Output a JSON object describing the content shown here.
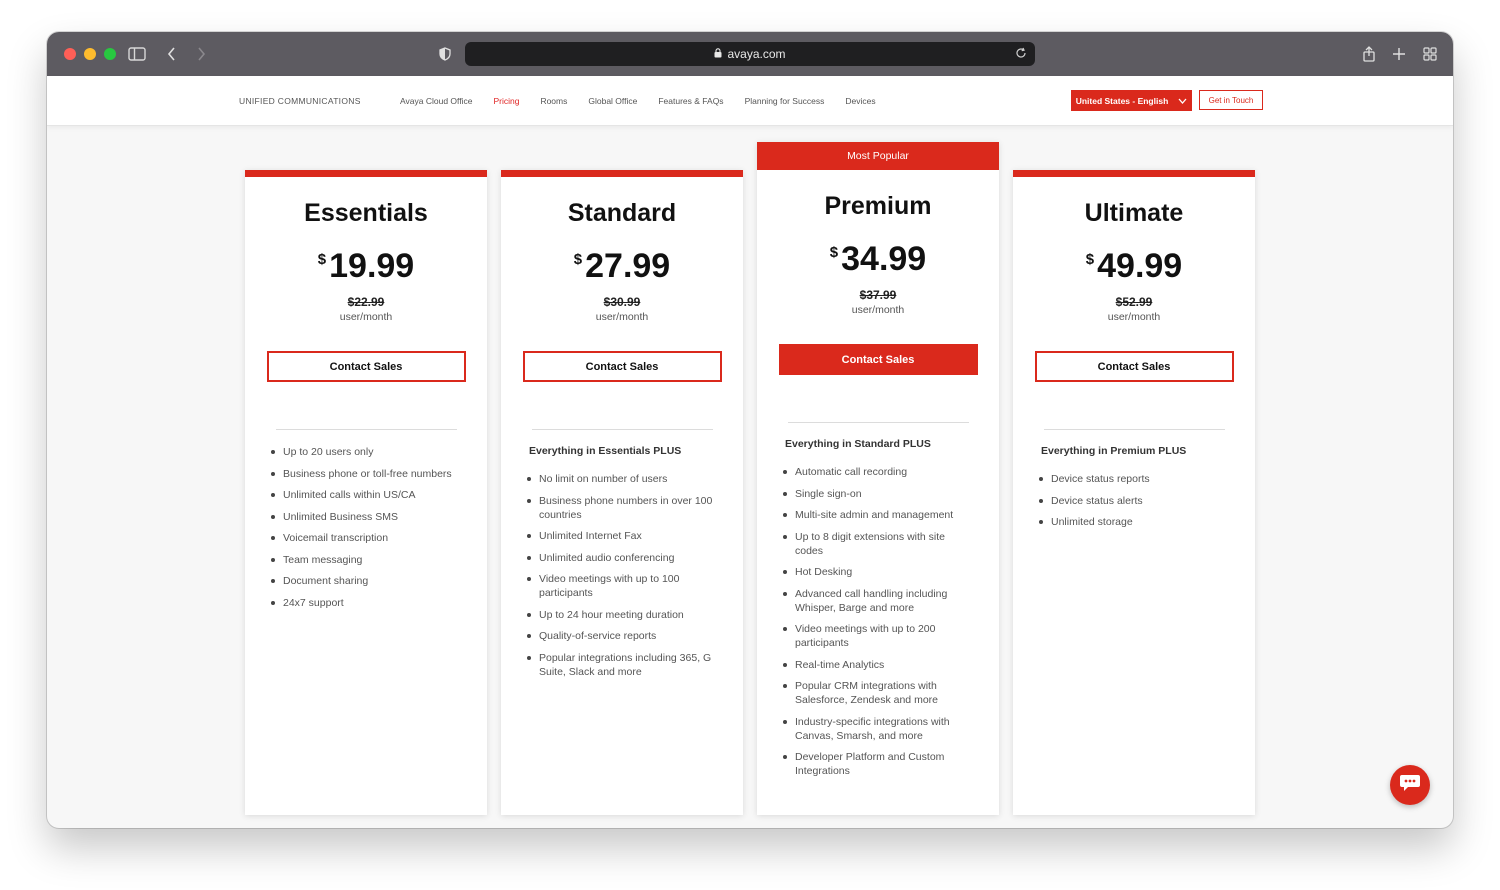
{
  "browser": {
    "url": "avaya.com"
  },
  "nav": {
    "brand": "UNIFIED COMMUNICATIONS",
    "links": [
      "Avaya Cloud Office",
      "Pricing",
      "Rooms",
      "Global Office",
      "Features & FAQs",
      "Planning for Success",
      "Devices"
    ],
    "active_link": "Pricing",
    "language_button": "United States - English",
    "contact_button": "Get in Touch"
  },
  "plans": [
    {
      "name": "Essentials",
      "currency": "$",
      "price": "19.99",
      "old_price": "$22.99",
      "period": "user/month",
      "cta": "Contact Sales",
      "plus_label": "",
      "features": [
        "Up to 20 users only",
        "Business phone or toll-free numbers",
        "Unlimited calls within US/CA",
        "Unlimited Business SMS",
        "Voicemail transcription",
        "Team messaging",
        "Document sharing",
        "24x7 support"
      ]
    },
    {
      "name": "Standard",
      "currency": "$",
      "price": "27.99",
      "old_price": "$30.99",
      "period": "user/month",
      "cta": "Contact Sales",
      "plus_label": "Everything in Essentials PLUS",
      "features": [
        "No limit on number of users",
        "Business phone numbers in over 100 countries",
        "Unlimited Internet Fax",
        "Unlimited audio conferencing",
        "Video meetings with up to 100 participants",
        "Up to 24 hour meeting duration",
        "Quality-of-service reports",
        "Popular integrations including 365, G Suite, Slack and more"
      ]
    },
    {
      "name": "Premium",
      "badge": "Most Popular",
      "currency": "$",
      "price": "34.99",
      "old_price": "$37.99",
      "period": "user/month",
      "cta": "Contact Sales",
      "plus_label": "Everything in Standard PLUS",
      "features": [
        "Automatic call recording",
        "Single sign-on",
        "Multi-site admin and management",
        "Up to 8 digit extensions with site codes",
        "Hot Desking",
        "Advanced call handling including Whisper, Barge and more",
        "Video meetings with up to 200 participants",
        "Real-time Analytics",
        "Popular CRM integrations with Salesforce, Zendesk and more",
        "Industry-specific integrations with Canvas, Smarsh, and more",
        "Developer Platform and Custom Integrations"
      ]
    },
    {
      "name": "Ultimate",
      "currency": "$",
      "price": "49.99",
      "old_price": "$52.99",
      "period": "user/month",
      "cta": "Contact Sales",
      "plus_label": "Everything in Premium PLUS",
      "features": [
        "Device status reports",
        "Device status alerts",
        "Unlimited storage"
      ]
    }
  ],
  "colors": {
    "brand_red": "#da291c",
    "titlebar": "#5d5b61"
  },
  "icons": {
    "sidebar": "sidebar-icon",
    "back": "chevron-left-icon",
    "forward": "chevron-right-icon",
    "privacy": "shield-icon",
    "lock": "lock-icon",
    "reload": "reload-icon",
    "share": "share-icon",
    "new_tab": "plus-icon",
    "tabs": "tab-grid-icon",
    "chat": "chat-icon"
  }
}
